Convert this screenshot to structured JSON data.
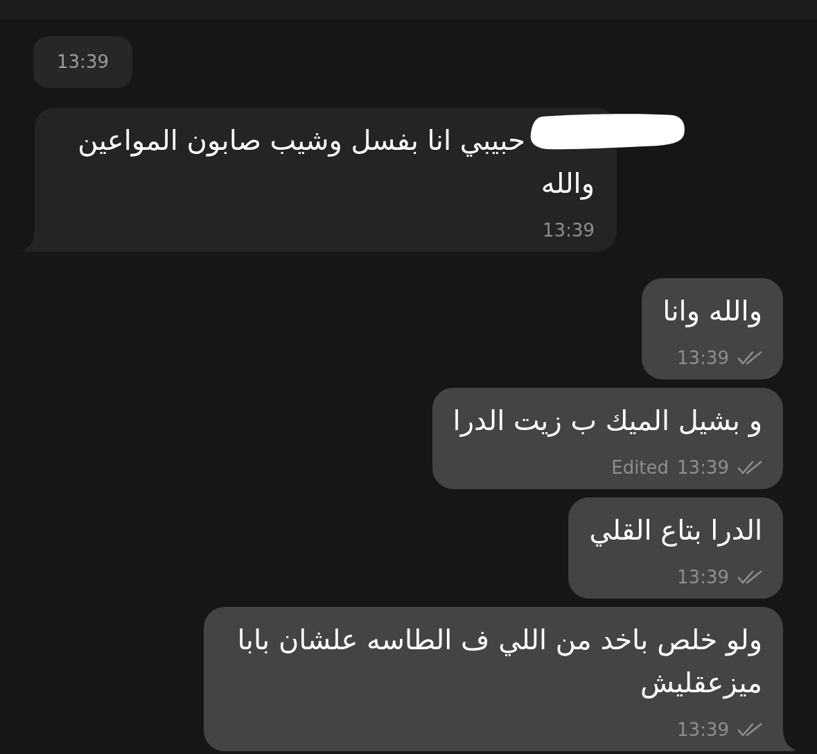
{
  "time_divider": {
    "text": "13:39"
  },
  "messages": [
    {
      "kind": "incoming",
      "text": "حبيبي انا بفسل وشيب صابون المواعين والله",
      "redacted": true,
      "time": "13:39",
      "tail": true
    },
    {
      "kind": "outgoing",
      "text": "والله وانا",
      "time": "13:39",
      "read": true,
      "tail": false
    },
    {
      "kind": "outgoing",
      "text": "و بشيل الميك ب زيت الدرا",
      "edited_label": "Edited",
      "time": "13:39",
      "read": true,
      "tail": false
    },
    {
      "kind": "outgoing",
      "text": "الدرا بتاع القلي",
      "time": "13:39",
      "read": true,
      "tail": false
    },
    {
      "kind": "outgoing",
      "text": "ولو خلص باخد من اللي ف الطاسه علشان بابا ميزعقليش",
      "time": "13:39",
      "read": true,
      "tail": true
    }
  ]
}
